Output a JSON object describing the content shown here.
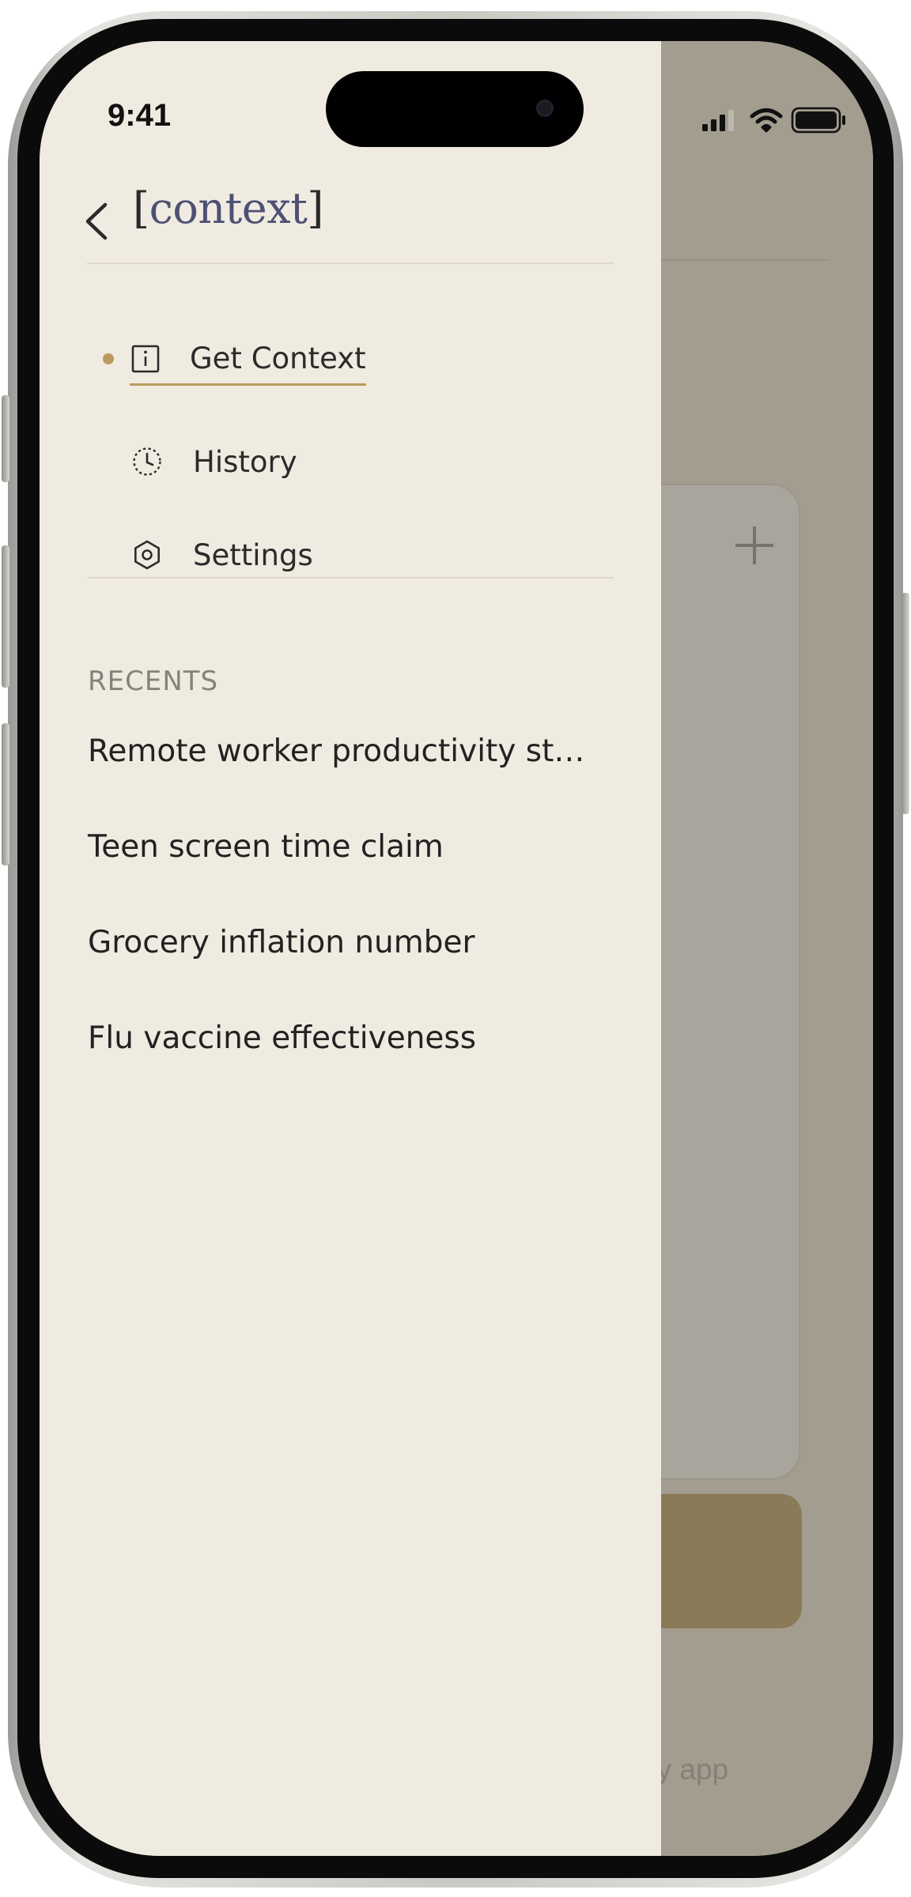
{
  "status_bar": {
    "time": "9:41",
    "signal_icon": "cellular-signal-icon",
    "wifi_icon": "wifi-icon",
    "battery_icon": "battery-icon"
  },
  "drawer": {
    "back_icon": "chevron-left-icon",
    "brand": {
      "open_bracket": "[",
      "word": "context",
      "close_bracket": "]"
    },
    "nav": [
      {
        "label": "Get Context",
        "icon": "info-icon",
        "active": true
      },
      {
        "label": "History",
        "icon": "clock-history-icon",
        "active": false
      },
      {
        "label": "Settings",
        "icon": "gear-icon",
        "active": false
      }
    ],
    "recents_header": "RECENTS",
    "recents": [
      "Remote worker productivity st…",
      "Teen screen time claim",
      "Grocery inflation number",
      "Flu vaccine effectiveness"
    ]
  },
  "background_app": {
    "plus_icon": "plus-icon",
    "footer_text_fragment": "ny app"
  },
  "colors": {
    "drawer_bg": "#f0ebe1",
    "accent_gold": "#bb9a5c",
    "brand_word": "#4d5173",
    "overlay_bg": "#a39d90",
    "bg_button": "#8a7a57"
  }
}
